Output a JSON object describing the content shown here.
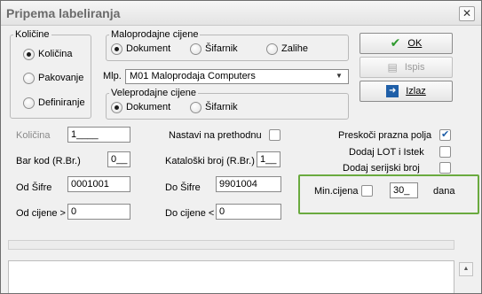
{
  "window": {
    "title": "Pripema labeliranja",
    "close_glyph": "✕"
  },
  "kolicine": {
    "title": "Količine",
    "options": [
      {
        "label": "Količina",
        "selected": true
      },
      {
        "label": "Pakovanje",
        "selected": false
      },
      {
        "label": "Definiranje",
        "selected": false
      }
    ]
  },
  "maloprodajne": {
    "title": "Maloprodajne cijene",
    "options": [
      {
        "label": "Dokument",
        "selected": true
      },
      {
        "label": "Šifarnik",
        "selected": false
      },
      {
        "label": "Zalihe",
        "selected": false
      }
    ],
    "mlp_label": "Mlp.",
    "mlp_value": "M01 Maloprodaja Computers"
  },
  "veleprodajne": {
    "title": "Veleprodajne cijene",
    "options": [
      {
        "label": "Dokument",
        "selected": true
      },
      {
        "label": "Šifarnik",
        "selected": false
      }
    ]
  },
  "buttons": {
    "ok": {
      "label": "OK",
      "icon": "checkmark-icon"
    },
    "ispis": {
      "label": "Ispis",
      "icon": "printer-icon"
    },
    "izlaz": {
      "label": "Izlaz",
      "icon": "exit-icon"
    }
  },
  "fields": {
    "kolicina": {
      "label": "Količina",
      "value": "1____"
    },
    "bar_kod": {
      "label": "Bar kod (R.Br.)",
      "value": "0__"
    },
    "od_sifre": {
      "label": "Od Šifre",
      "value": "0001001"
    },
    "od_cijene": {
      "label": "Od cijene >",
      "value": "0"
    },
    "nastavi": {
      "label": "Nastavi na prethodnu",
      "checked": false
    },
    "katalog": {
      "label": "Kataloški broj (R.Br.)",
      "value": "1__"
    },
    "do_sifre": {
      "label": "Do Šifre",
      "value": "9901004"
    },
    "do_cijene": {
      "label": "Do cijene <",
      "value": "0"
    }
  },
  "options_right": {
    "preskoci": {
      "label": "Preskoči prazna polja",
      "checked": true
    },
    "lot": {
      "label": "Dodaj LOT i Istek",
      "checked": false
    },
    "serijski": {
      "label": "Dodaj serijski broj",
      "checked": false
    }
  },
  "min_cijena": {
    "label": "Min.cijena",
    "checked": false,
    "value": "30_",
    "unit": "dana"
  },
  "colors": {
    "highlight": "#6aaa3f",
    "checkmark": "#2f9a2f",
    "exit_icon_bg": "#1f5fa8"
  }
}
